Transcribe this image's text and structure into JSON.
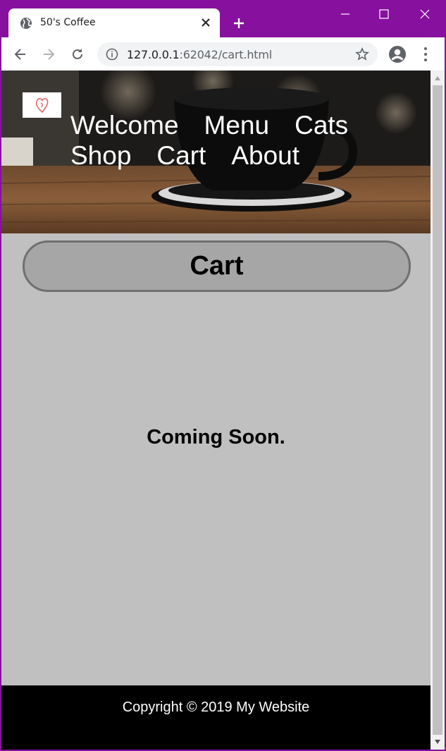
{
  "browser": {
    "tab_title": "50's Coffee",
    "url_host": "127.0.0.1",
    "url_rest": ":62042/cart.html",
    "frame_color": "#87119e"
  },
  "site": {
    "nav": [
      "Welcome",
      "Menu",
      "Cats",
      "Shop",
      "Cart",
      "About"
    ],
    "page_heading": "Cart",
    "message": "Coming Soon.",
    "footer": "Copyright © 2019 My Website",
    "colors": {
      "page_bg": "#c0c0c0",
      "pill_bg": "#a6a6a6",
      "pill_border": "#707070",
      "footer_bg": "#000000",
      "logo_accent": "#e06666"
    }
  }
}
